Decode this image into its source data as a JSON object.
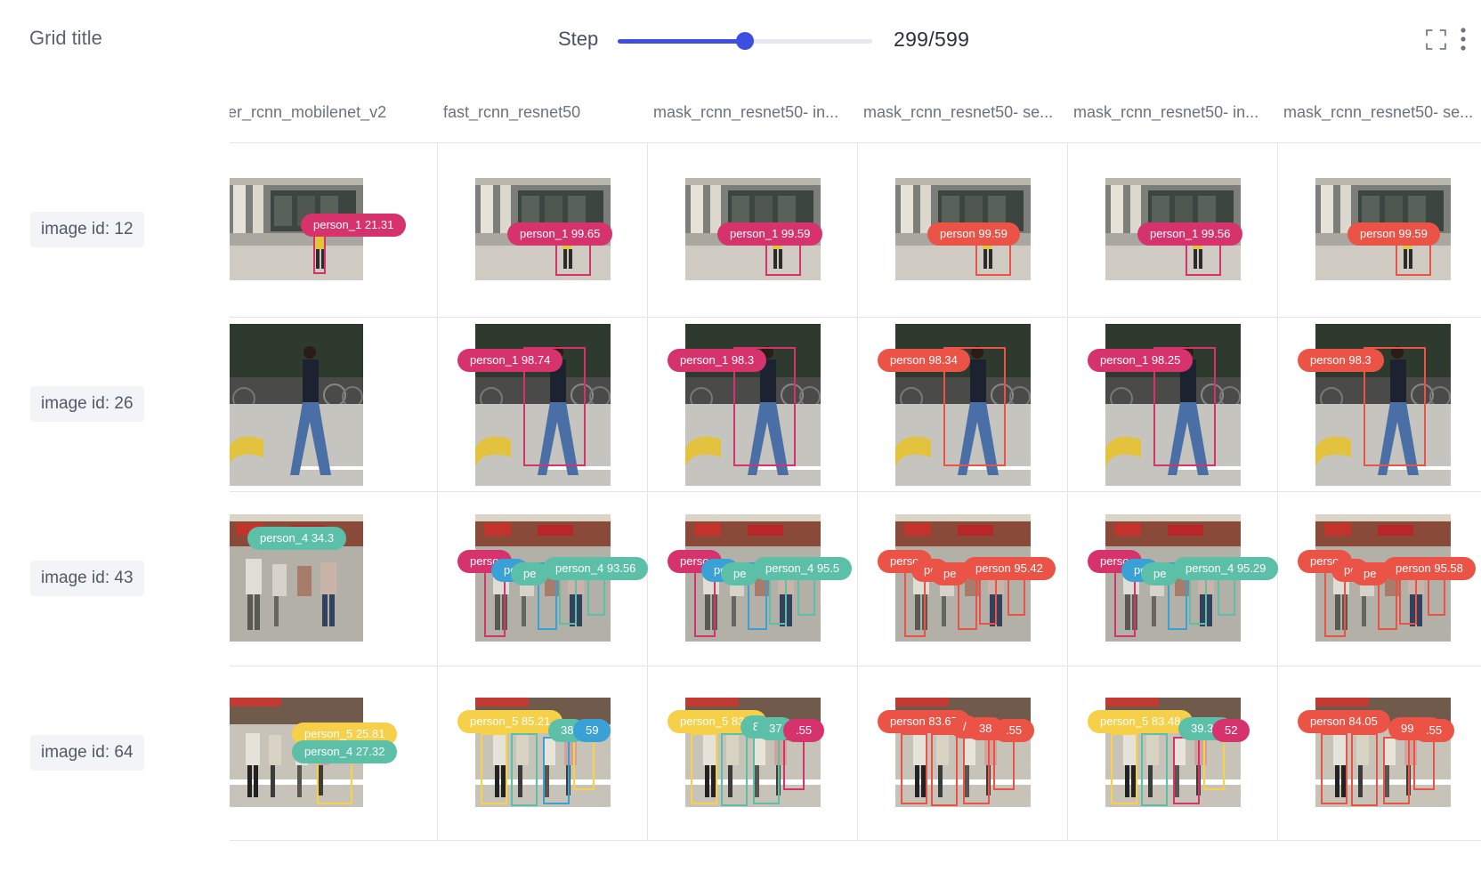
{
  "header": {
    "title": "Grid title",
    "step_label": "Step",
    "step_value": "299/599",
    "step_progress": 0.499
  },
  "colors": {
    "accent": "#3d4fe0",
    "pink": "#d6336c",
    "red": "#ec5347",
    "teal": "#5cbfa8",
    "blue": "#3aa1d6",
    "yellow": "#f7d04a"
  },
  "columns": [
    "er_rcnn_mobilenet_v2",
    "fast_rcnn_resnet50",
    "mask_rcnn_resnet50- in...",
    "mask_rcnn_resnet50- se...",
    "mask_rcnn_resnet50- in...",
    "mask_rcnn_resnet50- se..."
  ],
  "rows": [
    {
      "label": "image id: 12",
      "scene": "building",
      "cells": [
        {
          "labels": [
            {
              "text": "person_1 21.31",
              "color": "pink"
            }
          ]
        },
        {
          "labels": [
            {
              "text": "person_1 99.65",
              "color": "pink"
            }
          ]
        },
        {
          "labels": [
            {
              "text": "person_1 99.59",
              "color": "pink"
            }
          ]
        },
        {
          "labels": [
            {
              "text": "person 99.59",
              "color": "red"
            }
          ]
        },
        {
          "labels": [
            {
              "text": "person_1 99.56",
              "color": "pink"
            }
          ]
        },
        {
          "labels": [
            {
              "text": "person 99.59",
              "color": "red"
            }
          ]
        }
      ]
    },
    {
      "label": "image id: 26",
      "scene": "street",
      "cells": [
        {
          "labels": []
        },
        {
          "labels": [
            {
              "text": "person_1 98.74",
              "color": "pink"
            }
          ]
        },
        {
          "labels": [
            {
              "text": "person_1 98.3",
              "color": "pink"
            }
          ]
        },
        {
          "labels": [
            {
              "text": "person 98.34",
              "color": "red"
            }
          ]
        },
        {
          "labels": [
            {
              "text": "person_1 98.25",
              "color": "pink"
            }
          ]
        },
        {
          "labels": [
            {
              "text": "person 98.3",
              "color": "red"
            }
          ]
        }
      ]
    },
    {
      "label": "image id: 43",
      "scene": "crowd",
      "cells": [
        {
          "labels": [
            {
              "text": "person_4 34.3",
              "color": "teal"
            }
          ]
        },
        {
          "labels": [
            {
              "text": "perso",
              "color": "pink"
            },
            {
              "text": "pe",
              "color": "blue"
            },
            {
              "text": "pe",
              "color": "teal"
            },
            {
              "text": "person_4 93.56",
              "color": "teal"
            }
          ]
        },
        {
          "labels": [
            {
              "text": "perso",
              "color": "pink"
            },
            {
              "text": "pe",
              "color": "blue"
            },
            {
              "text": "pe",
              "color": "teal"
            },
            {
              "text": "person_4 95.5",
              "color": "teal"
            }
          ]
        },
        {
          "labels": [
            {
              "text": "perso",
              "color": "red"
            },
            {
              "text": "pe",
              "color": "red"
            },
            {
              "text": "pe",
              "color": "red"
            },
            {
              "text": "person 95.42",
              "color": "red"
            }
          ]
        },
        {
          "labels": [
            {
              "text": "perso",
              "color": "pink"
            },
            {
              "text": "pe",
              "color": "blue"
            },
            {
              "text": "pe",
              "color": "teal"
            },
            {
              "text": "person_4 95.29",
              "color": "teal"
            }
          ]
        },
        {
          "labels": [
            {
              "text": "perso",
              "color": "red"
            },
            {
              "text": "pe",
              "color": "red"
            },
            {
              "text": "pe",
              "color": "red"
            },
            {
              "text": "person 95.58",
              "color": "red"
            }
          ]
        }
      ]
    },
    {
      "label": "image id: 64",
      "scene": "crossing",
      "cells": [
        {
          "labels": [
            {
              "text": "person_5 25.81",
              "color": "yellow"
            },
            {
              "text": "person_4 27.32",
              "color": "teal"
            }
          ]
        },
        {
          "labels": [
            {
              "text": "person_5 85.21",
              "color": "yellow"
            },
            {
              "text": "38",
              "color": "teal"
            },
            {
              "text": "59",
              "color": "blue"
            }
          ]
        },
        {
          "labels": [
            {
              "text": "person_5 83.8",
              "color": "yellow"
            },
            {
              "text": "8",
              "color": "teal"
            },
            {
              "text": "37",
              "color": "teal"
            },
            {
              "text": ".55",
              "color": "pink"
            }
          ]
        },
        {
          "labels": [
            {
              "text": "person 83.67",
              "color": "red"
            },
            {
              "text": "/",
              "color": "red"
            },
            {
              "text": "38",
              "color": "red"
            },
            {
              "text": ".55",
              "color": "red"
            }
          ]
        },
        {
          "labels": [
            {
              "text": "person_5 83.48",
              "color": "yellow"
            },
            {
              "text": "39.35",
              "color": "teal"
            },
            {
              "text": "52",
              "color": "pink"
            }
          ]
        },
        {
          "labels": [
            {
              "text": "person 84.05",
              "color": "red"
            },
            {
              "text": "99.37",
              "color": "red"
            },
            {
              "text": ".55",
              "color": "red"
            }
          ]
        }
      ]
    }
  ]
}
